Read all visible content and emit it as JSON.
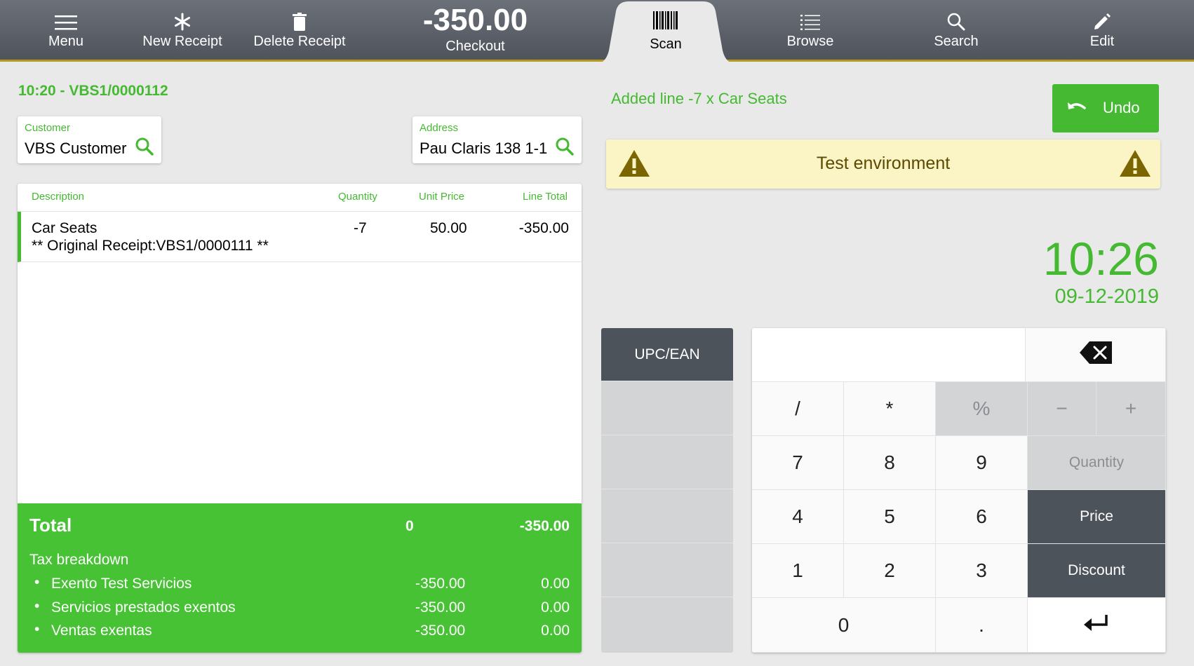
{
  "topbar": {
    "menu": "Menu",
    "new_receipt": "New Receipt",
    "delete_receipt": "Delete Receipt",
    "checkout_amount": "-350.00",
    "checkout": "Checkout",
    "scan": "Scan",
    "browse": "Browse",
    "search": "Search",
    "edit": "Edit"
  },
  "receipt": {
    "id": "10:20 - VBS1/0000112",
    "customer_label": "Customer",
    "customer": "VBS Customer",
    "address_label": "Address",
    "address": "Pau Claris 138 1-1"
  },
  "table": {
    "headers": {
      "description": "Description",
      "quantity": "Quantity",
      "unit_price": "Unit Price",
      "line_total": "Line Total"
    },
    "lines": [
      {
        "description": "Car Seats",
        "note": "** Original Receipt:VBS1/0000111 **",
        "quantity": "-7",
        "unit_price": "50.00",
        "line_total": "-350.00"
      }
    ]
  },
  "totals": {
    "label": "Total",
    "quantity": "0",
    "amount": "-350.00",
    "tax_breakdown_label": "Tax breakdown",
    "taxes": [
      {
        "name": "Exento Test Servicios",
        "base": "-350.00",
        "tax": "0.00"
      },
      {
        "name": "Servicios prestados exentos",
        "base": "-350.00",
        "tax": "0.00"
      },
      {
        "name": "Ventas exentas",
        "base": "-350.00",
        "tax": "0.00"
      }
    ]
  },
  "status": {
    "message": "Added line -7 x Car Seats",
    "undo": "Undo",
    "environment": "Test environment"
  },
  "clock": {
    "time": "10:26",
    "date": "09-12-2019"
  },
  "scan_panel": {
    "category": "UPC/EAN"
  },
  "keypad": {
    "slash": "/",
    "star": "*",
    "percent": "%",
    "minus": "−",
    "plus": "+",
    "k7": "7",
    "k8": "8",
    "k9": "9",
    "quantity": "Quantity",
    "k4": "4",
    "k5": "5",
    "k6": "6",
    "price": "Price",
    "k1": "1",
    "k2": "2",
    "k3": "3",
    "discount": "Discount",
    "k0": "0",
    "dot": "."
  },
  "colors": {
    "accent": "#44b931",
    "dark": "#4d535b",
    "warning_bg": "#fbf4c5"
  }
}
